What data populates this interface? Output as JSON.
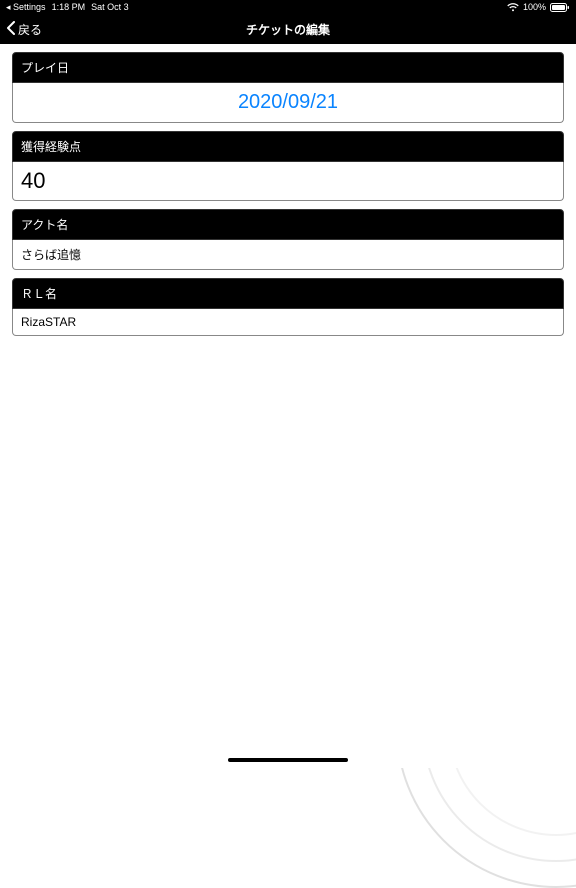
{
  "status": {
    "breadcrumb": "Settings",
    "time": "1:18 PM",
    "date": "Sat Oct 3",
    "battery_pct": "100%"
  },
  "nav": {
    "back_label": "戻る",
    "title": "チケットの編集"
  },
  "form": {
    "play_date": {
      "label": "プレイ日",
      "value": "2020/09/21"
    },
    "exp": {
      "label": "獲得経験点",
      "value": "40"
    },
    "act_name": {
      "label": "アクト名",
      "value": "さらば追憶"
    },
    "rl_name": {
      "label": "ＲＬ名",
      "value": "RizaSTAR"
    }
  }
}
